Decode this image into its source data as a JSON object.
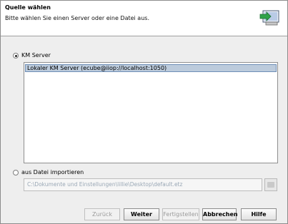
{
  "header": {
    "title": "Quelle wählen",
    "subtitle": "Bitte wählen Sie einen Server oder eine Datei aus.",
    "icon": "monitor-import-icon"
  },
  "options": {
    "km_server": {
      "label": "KM Server",
      "selected": true
    },
    "import_file": {
      "label": "aus Datei importieren",
      "selected": false
    }
  },
  "server_list": {
    "items": [
      "Lokaler KM Server (ecube@iiop://localhost:1050)"
    ],
    "selected_index": 0
  },
  "file_path": {
    "value": "C:\\Dokumente und Einstellungen\\lillie\\Desktop\\default.etz",
    "enabled": false
  },
  "buttons": {
    "back": "Zurück",
    "next": "Weiter",
    "finish": "Fertigstellen",
    "cancel": "Abbrechen",
    "help": "Hilfe"
  },
  "colors": {
    "header_bg": "#ffffff",
    "dialog_bg": "#eeeeee",
    "selection_bg": "#bccbdc",
    "selection_border": "#6f8fb7"
  }
}
